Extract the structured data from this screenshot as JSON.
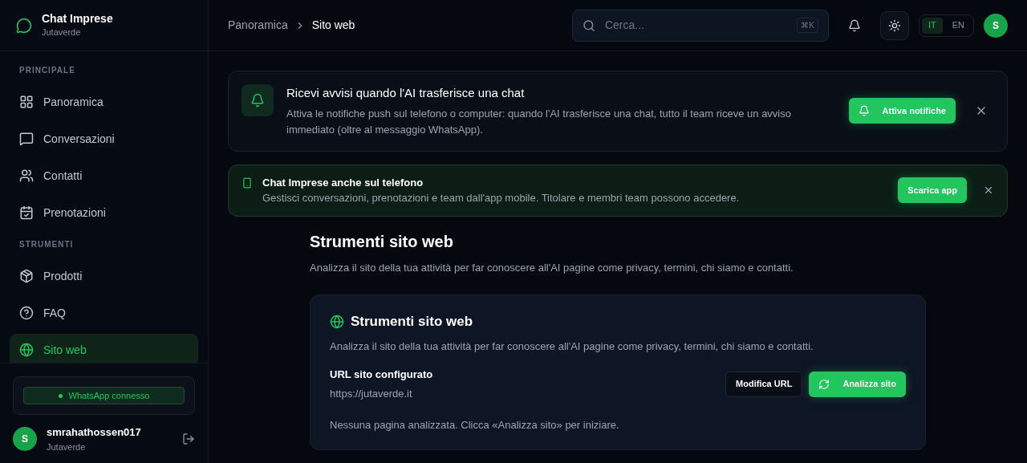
{
  "brand": {
    "title": "Chat Imprese",
    "subtitle": "Jutaverde"
  },
  "sidebar": {
    "sections": [
      {
        "heading": "PRINCIPALE",
        "items": [
          {
            "label": "Panoramica",
            "kind": "grid",
            "selected": false
          },
          {
            "label": "Conversazioni",
            "kind": "chat",
            "selected": false
          },
          {
            "label": "Contatti",
            "kind": "users",
            "selected": false
          },
          {
            "label": "Prenotazioni",
            "kind": "calendar",
            "selected": false
          }
        ]
      },
      {
        "heading": "STRUMENTI",
        "items": [
          {
            "label": "Prodotti",
            "kind": "package",
            "selected": false
          },
          {
            "label": "FAQ",
            "kind": "help",
            "selected": false
          },
          {
            "label": "Sito web",
            "kind": "globe",
            "selected": true
          }
        ]
      }
    ],
    "whatsapp_status": {
      "label": "WhatsApp connesso",
      "connected": true
    },
    "user": {
      "avatar": "S",
      "name": "smrahathossen017",
      "company": "Jutaverde"
    }
  },
  "breadcrumb": [
    "Panoramica",
    "Sito web"
  ],
  "search": {
    "placeholder": "Cerca...",
    "shortcut": "⌘K"
  },
  "languages": [
    {
      "label": "IT",
      "selected": true
    },
    {
      "label": "EN",
      "selected": false
    }
  ],
  "header_avatar": "S",
  "notification_banner": {
    "title": "Ricevi avvisi quando l'AI trasferisce una chat",
    "text": "Attiva le notifiche push sul telefono o computer: quando l'AI trasferisce una chat, tutto il team riceve un avviso immediato (oltre al messaggio WhatsApp).",
    "button": "Attiva notifiche"
  },
  "app_banner": {
    "title": "Chat Imprese anche sul telefono",
    "text": "Gestisci conversazioni, prenotazioni e team dall'app mobile. Titolare e membri team possono accedere.",
    "button": "Scarica app"
  },
  "page": {
    "title": "Strumenti sito web",
    "subtitle": "Analizza il sito della tua attività per far conoscere all'AI pagine come privacy, termini, chi siamo e contatti."
  },
  "card": {
    "title": "Strumenti sito web",
    "subtitle": "Analizza il sito della tua attività per far conoscere all'AI pagine come privacy, termini, chi siamo e contatti.",
    "url_label": "URL sito configurato",
    "url": "https://jutaverde.it",
    "edit_button": "Modifica URL",
    "analyze_button": "Analizza sito",
    "empty_text": "Nessuna pagina analizzata. Clicca «Analizza sito» per iniziare."
  }
}
